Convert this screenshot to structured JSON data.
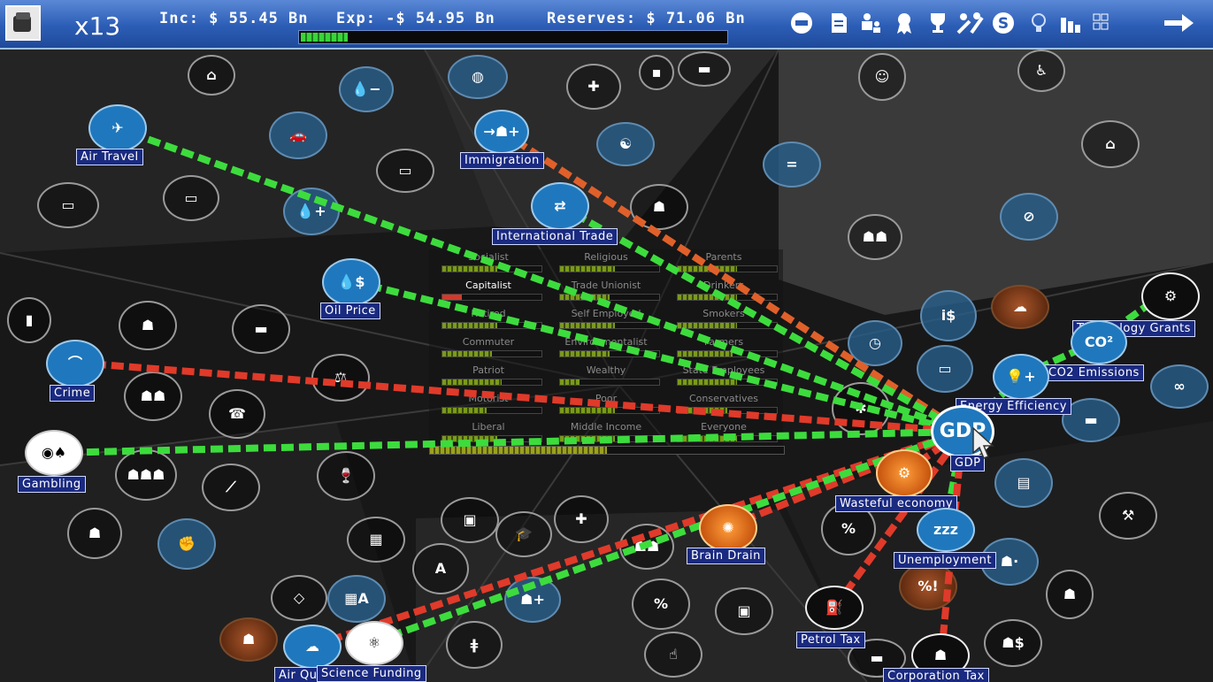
{
  "topbar": {
    "turns": "x13",
    "income": "Inc: $ 55.45 Bn",
    "expense": "Exp: -$ 54.95 Bn",
    "reserves": "Reserves: $ 71.06 Bn",
    "budget_fraction": 0.11,
    "tools": [
      "finance-icon",
      "document-icon",
      "cabinet-icon",
      "award-ribbon-icon",
      "trophy-icon",
      "tools-icon",
      "dollar-coin-icon",
      "lightbulb-icon",
      "bar-chart-icon",
      "grid-icon",
      "next-turn-arrow-icon"
    ]
  },
  "nodes": {
    "air_travel": "Air Travel",
    "immigration": "Immigration",
    "international_trade": "International Trade",
    "oil_price": "Oil Price",
    "crime": "Crime",
    "gambling": "Gambling",
    "technology_grants": "Technology Grants",
    "co2_emissions": "CO2 Emissions",
    "energy_efficiency": "Energy Efficiency",
    "gdp": "GDP",
    "gdp_glyph": "GDP",
    "wasteful_economy": "Wasteful economy",
    "brain_drain": "Brain Drain",
    "unemployment": "Unemployment",
    "petrol_tax": "Petrol Tax",
    "air_quality": "Air Quality",
    "science_funding": "Science Funding",
    "corporation_tax": "Corporation Tax"
  },
  "voters": {
    "groups": [
      {
        "name": "Socialist",
        "level": 0.55
      },
      {
        "name": "Religious",
        "level": 0.55
      },
      {
        "name": "Parents",
        "level": 0.6
      },
      {
        "name": "Capitalist",
        "level": 0.2,
        "selected": true
      },
      {
        "name": "Trade Unionist",
        "level": 0.5
      },
      {
        "name": "Drinkers",
        "level": 0.6
      },
      {
        "name": "Retired",
        "level": 0.55
      },
      {
        "name": "Self Employed",
        "level": 0.55
      },
      {
        "name": "Smokers",
        "level": 0.6
      },
      {
        "name": "Commuter",
        "level": 0.5
      },
      {
        "name": "Environmentalist",
        "level": 0.5
      },
      {
        "name": "Farmers",
        "level": 0.55
      },
      {
        "name": "Patriot",
        "level": 0.6
      },
      {
        "name": "Wealthy",
        "level": 0.2
      },
      {
        "name": "State Employees",
        "level": 0.6
      },
      {
        "name": "Motorist",
        "level": 0.45
      },
      {
        "name": "Poor",
        "level": 0.55
      },
      {
        "name": "Conservatives",
        "level": 0.5
      },
      {
        "name": "Liberal",
        "level": 0.55
      },
      {
        "name": "Middle Income",
        "level": 0.55
      },
      {
        "name": "Everyone",
        "level": 0.6
      }
    ],
    "everyone_level": 0.5
  },
  "colors": {
    "positive": "#3ddc3d",
    "negative": "#e03a2a"
  }
}
